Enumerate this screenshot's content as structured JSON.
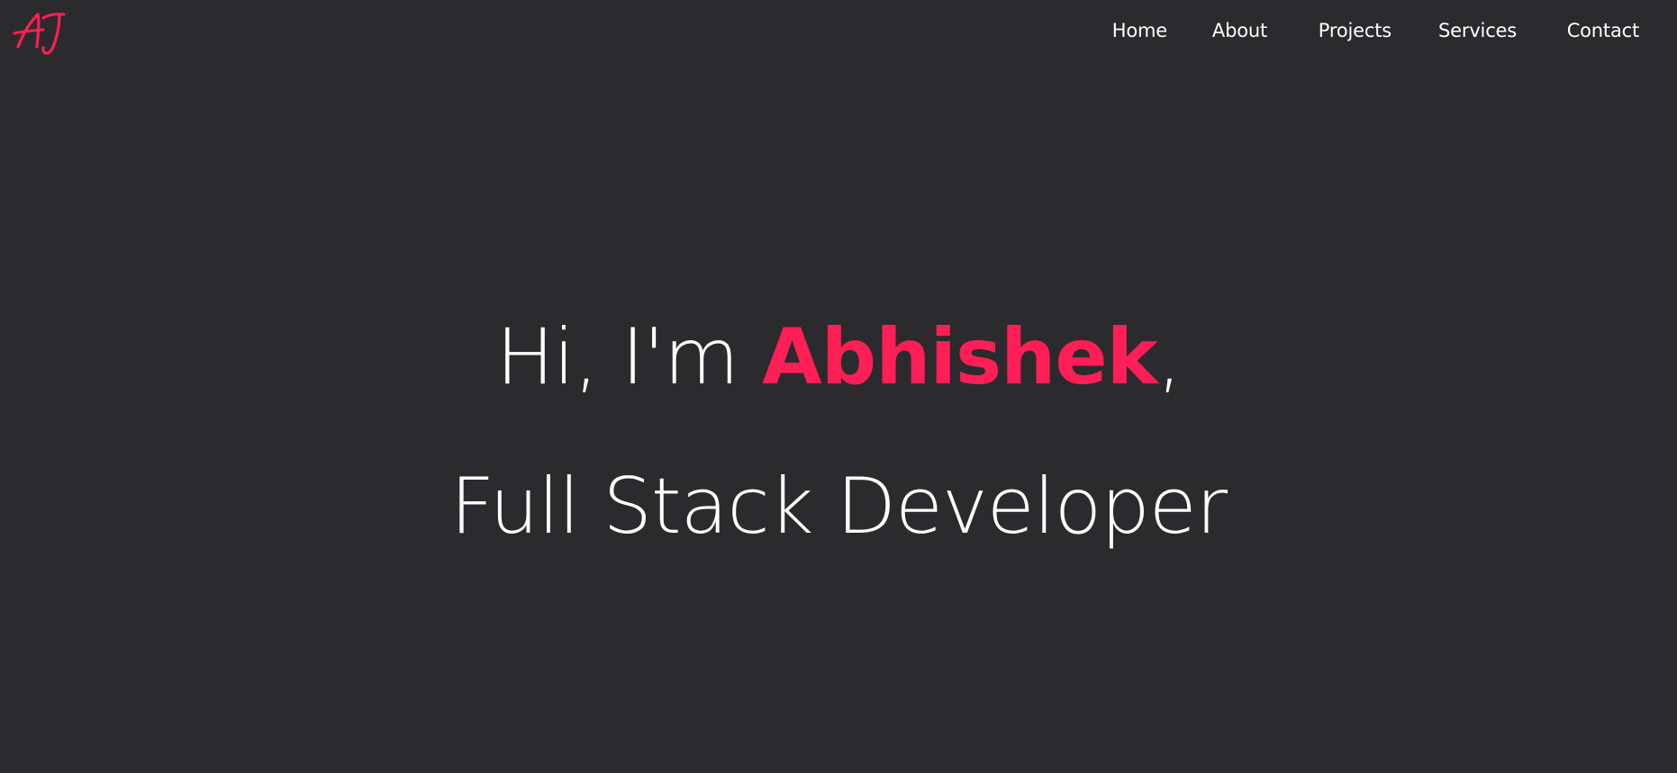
{
  "logo": {
    "text": "AJ",
    "color": "#ff1e56"
  },
  "nav": {
    "items": [
      {
        "label": "Home"
      },
      {
        "label": "About"
      },
      {
        "label": "Projects"
      },
      {
        "label": "Services"
      },
      {
        "label": "Contact"
      }
    ]
  },
  "hero": {
    "greeting": "Hi, I'm ",
    "name": "Abhishek",
    "comma": ",",
    "role": "Full Stack Developer",
    "accent_color": "#ff1e56",
    "text_color": "#ffffff"
  },
  "theme": {
    "background": "#2b2b2d"
  }
}
